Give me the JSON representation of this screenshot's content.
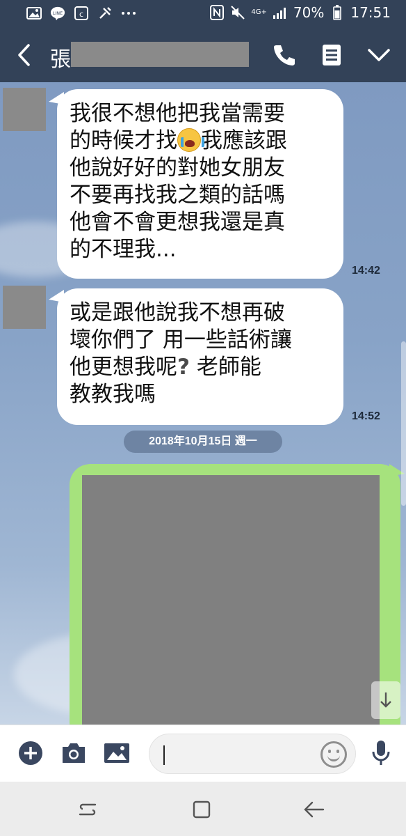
{
  "status_bar": {
    "battery": "70%",
    "time": "17:51",
    "network": "4G+",
    "icons": [
      "image-icon",
      "line-icon",
      "app-icon",
      "more-dots-icon",
      "nfc-icon",
      "mute-icon",
      "signal-icon",
      "battery-icon"
    ]
  },
  "header": {
    "contact_name": "張",
    "icons": [
      "back-arrow-icon",
      "phone-icon",
      "notes-icon",
      "chevron-down-icon"
    ]
  },
  "messages": [
    {
      "lines": [
        "我很不想他把我當需要",
        "的時候才找",
        "我應該跟",
        "他說好好的對她女朋友",
        "不要再找我之類的話嗎",
        "他會不會更想我還是真",
        "的不理我..."
      ],
      "time": "14:42",
      "emoji": "crying-face-emoji"
    },
    {
      "lines": [
        " 或是跟他說我不想再破",
        "壞你們了 用一些話術讓",
        "他更想我呢",
        " 老師能",
        "教教我嗎"
      ],
      "time": "14:52",
      "emoji": "question-mark-icon"
    }
  ],
  "date_separator": "2018年10月15日 週一",
  "input": {
    "value": "",
    "placeholder": ""
  },
  "colors": {
    "header_bg": "#334258",
    "sent_bubble": "#a6e27d",
    "received_bubble": "#ffffff",
    "chat_bg": "#88a3c7"
  }
}
